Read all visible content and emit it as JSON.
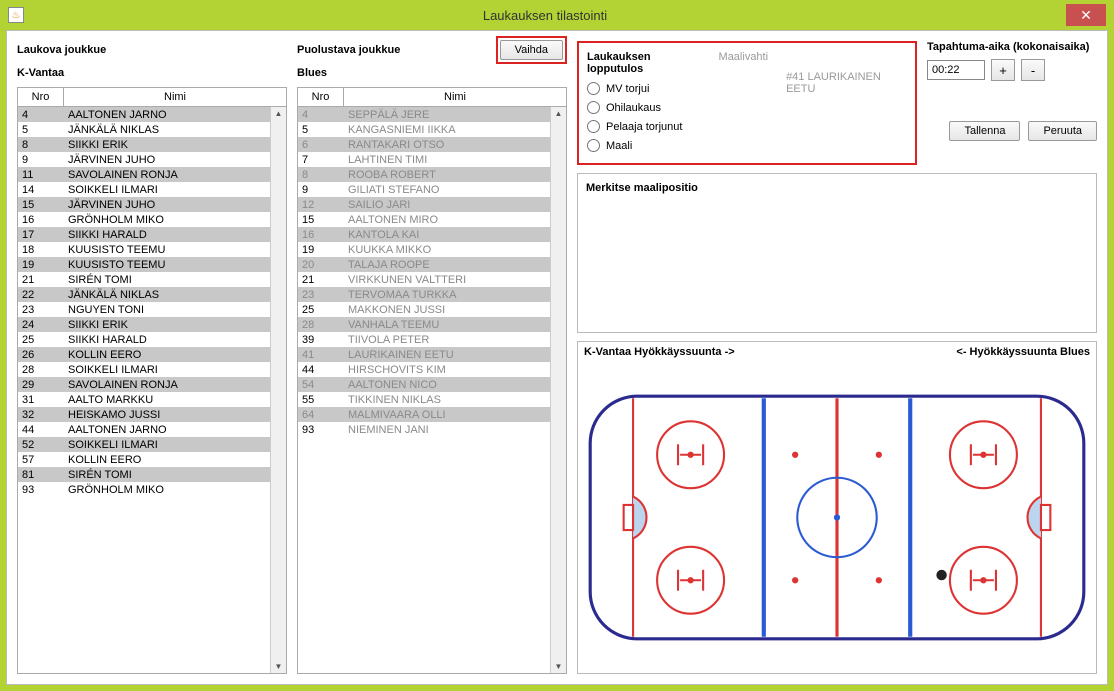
{
  "window": {
    "title": "Laukauksen tilastointi"
  },
  "left": {
    "section_label": "Laukova joukkue",
    "team": "K-Vantaa",
    "headers": {
      "nro": "Nro",
      "nimi": "Nimi"
    },
    "rows": [
      {
        "n": "4",
        "name": "AALTONEN JARNO",
        "stripe": true
      },
      {
        "n": "5",
        "name": "JÄNKÄLÄ NIKLAS",
        "stripe": false
      },
      {
        "n": "8",
        "name": "SIIKKI ERIK",
        "stripe": true
      },
      {
        "n": "9",
        "name": "JÄRVINEN JUHO",
        "stripe": false
      },
      {
        "n": "11",
        "name": "SAVOLAINEN RONJA",
        "stripe": true
      },
      {
        "n": "14",
        "name": "SOIKKELI ILMARI",
        "stripe": false
      },
      {
        "n": "15",
        "name": "JÄRVINEN JUHO",
        "stripe": true
      },
      {
        "n": "16",
        "name": "GRÖNHOLM MIKO",
        "stripe": false
      },
      {
        "n": "17",
        "name": "SIIKKI HARALD",
        "stripe": true
      },
      {
        "n": "18",
        "name": "KUUSISTO TEEMU",
        "stripe": false
      },
      {
        "n": "19",
        "name": "KUUSISTO TEEMU",
        "stripe": true
      },
      {
        "n": "21",
        "name": "SIRÉN TOMI",
        "stripe": false
      },
      {
        "n": "22",
        "name": "JÄNKÄLÄ NIKLAS",
        "stripe": true
      },
      {
        "n": "23",
        "name": "NGUYEN TONI",
        "stripe": false
      },
      {
        "n": "24",
        "name": "SIIKKI ERIK",
        "stripe": true
      },
      {
        "n": "25",
        "name": "SIIKKI HARALD",
        "stripe": false
      },
      {
        "n": "26",
        "name": "KOLLIN EERO",
        "stripe": true
      },
      {
        "n": "28",
        "name": "SOIKKELI ILMARI",
        "stripe": false
      },
      {
        "n": "29",
        "name": "SAVOLAINEN RONJA",
        "stripe": true
      },
      {
        "n": "31",
        "name": "AALTO MARKKU",
        "stripe": false
      },
      {
        "n": "32",
        "name": "HEISKAMO JUSSI",
        "stripe": true
      },
      {
        "n": "44",
        "name": "AALTONEN JARNO",
        "stripe": false
      },
      {
        "n": "52",
        "name": "SOIKKELI ILMARI",
        "stripe": true
      },
      {
        "n": "57",
        "name": "KOLLIN EERO",
        "stripe": false
      },
      {
        "n": "81",
        "name": "SIRÉN TOMI",
        "stripe": true
      },
      {
        "n": "93",
        "name": "GRÖNHOLM MIKO",
        "stripe": false
      }
    ]
  },
  "mid": {
    "section_label": "Puolustava joukkue",
    "swap_label": "Vaihda",
    "team": "Blues",
    "headers": {
      "nro": "Nro",
      "nimi": "Nimi"
    },
    "rows": [
      {
        "n": "4",
        "name": "SEPPÄLÄ JERE",
        "stripe": true,
        "dimrow": true
      },
      {
        "n": "5",
        "name": "KANGASNIEMI IIKKA",
        "stripe": false,
        "dim": true
      },
      {
        "n": "6",
        "name": "RANTAKARI OTSO",
        "stripe": true,
        "dimrow": true
      },
      {
        "n": "7",
        "name": "LAHTINEN TIMI",
        "stripe": false,
        "dim": true
      },
      {
        "n": "8",
        "name": "ROOBA ROBERT",
        "stripe": true,
        "dimrow": true
      },
      {
        "n": "9",
        "name": "GILIATI STEFANO",
        "stripe": false,
        "dim": true
      },
      {
        "n": "12",
        "name": "SAILIO JARI",
        "stripe": true,
        "dimrow": true
      },
      {
        "n": "15",
        "name": "AALTONEN MIRO",
        "stripe": false,
        "dim": true
      },
      {
        "n": "16",
        "name": "KANTOLA KAI",
        "stripe": true,
        "dimrow": true
      },
      {
        "n": "19",
        "name": "KUUKKA MIKKO",
        "stripe": false,
        "dim": true
      },
      {
        "n": "20",
        "name": "TALAJA ROOPE",
        "stripe": true,
        "dimrow": true
      },
      {
        "n": "21",
        "name": "VIRKKUNEN VALTTERI",
        "stripe": false,
        "dim": true
      },
      {
        "n": "23",
        "name": "TERVOMAA TURKKA",
        "stripe": true,
        "dimrow": true
      },
      {
        "n": "25",
        "name": "MAKKONEN JUSSI",
        "stripe": false,
        "dim": true
      },
      {
        "n": "28",
        "name": "VANHALA TEEMU",
        "stripe": true,
        "dimrow": true
      },
      {
        "n": "39",
        "name": "TIIVOLA PETER",
        "stripe": false,
        "dim": true
      },
      {
        "n": "41",
        "name": "LAURIKAINEN EETU",
        "stripe": true,
        "dimrow": true
      },
      {
        "n": "44",
        "name": "HIRSCHOVITS KIM",
        "stripe": false,
        "dim": true
      },
      {
        "n": "54",
        "name": "AALTONEN NICO",
        "stripe": true,
        "dimrow": true
      },
      {
        "n": "55",
        "name": "TIKKINEN NIKLAS",
        "stripe": false,
        "dim": true
      },
      {
        "n": "64",
        "name": "MALMIVAARA OLLI",
        "stripe": true,
        "dimrow": true
      },
      {
        "n": "93",
        "name": "NIEMINEN JANI",
        "stripe": false,
        "dim": true
      }
    ]
  },
  "outcome": {
    "title": "Laukauksen lopputulos",
    "goalie_label": "Maalivahti",
    "goalie_value": "#41 LAURIKAINEN EETU",
    "opts": [
      {
        "label": "MV torjui"
      },
      {
        "label": "Ohilaukaus"
      },
      {
        "label": "Pelaaja torjunut"
      },
      {
        "label": "Maali"
      }
    ]
  },
  "time": {
    "title": "Tapahtuma-aika (kokonaisaika)",
    "value": "00:22",
    "plus": "+",
    "minus": "-"
  },
  "actions": {
    "save": "Tallenna",
    "cancel": "Peruuta"
  },
  "mark": {
    "title": "Merkitse maalipositio"
  },
  "rink": {
    "left_label": "K-Vantaa Hyökkäyssuunta ->",
    "right_label": "<- Hyökkäyssuunta Blues"
  }
}
